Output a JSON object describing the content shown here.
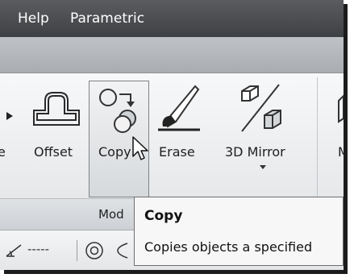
{
  "menubar": {
    "items": [
      {
        "label": "Help"
      },
      {
        "label": "Parametric"
      }
    ]
  },
  "ribbon": {
    "tools": [
      {
        "label": "e",
        "icon": "move-arrow-icon"
      },
      {
        "label": "Offset",
        "icon": "offset-icon"
      },
      {
        "label": "Copy",
        "icon": "copy-icon"
      },
      {
        "label": "Erase",
        "icon": "erase-icon"
      },
      {
        "label": "3D Mirror",
        "icon": "3d-mirror-icon"
      },
      {
        "label": "M",
        "icon": "3d-move-icon"
      }
    ],
    "panel_title": "Mod"
  },
  "tooltip": {
    "title": "Copy",
    "description": "Copies objects a specified"
  },
  "bottom_toolbar": {
    "icons": [
      "angle-icon",
      "dashed-line-icon",
      "circle-target-icon",
      "orbit-icon"
    ],
    "dash_text": "-----"
  },
  "colors": {
    "menubar_bg": "#4a4c4f",
    "ribbon_bg": "#eceef0",
    "highlight_border": "#7e8286",
    "tooltip_bg": "#f7f7f7"
  }
}
